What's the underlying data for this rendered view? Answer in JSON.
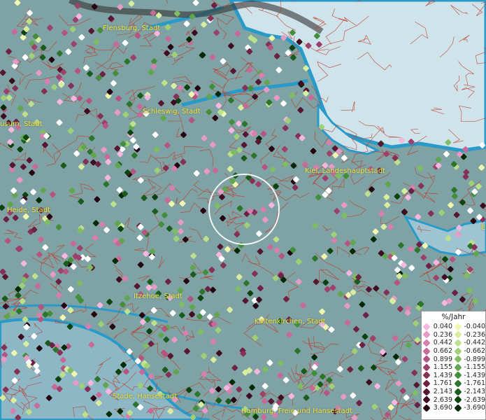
{
  "map": {
    "cities": [
      {
        "id": "flensburg",
        "name": "Flensburg, Stadt"
      },
      {
        "id": "husum",
        "name": "usum, Stadt"
      },
      {
        "id": "schleswig",
        "name": "Schleswig, Stadt"
      },
      {
        "id": "kiel",
        "name": "Kiel, Landeshauptstadt"
      },
      {
        "id": "heide",
        "name": "Heide, Stadt"
      },
      {
        "id": "itzehoe",
        "name": "Itzehoe, Stadt"
      },
      {
        "id": "kaltenkirchen",
        "name": "Kaltenkirchen, Stadt"
      },
      {
        "id": "stade",
        "name": "Stade, Hansestadt"
      },
      {
        "id": "hamburg",
        "name": "Hamburg, Freie und Hansestadt"
      },
      {
        "id": "edge",
        "name": "E"
      }
    ],
    "colors": {
      "land": "#7fa2a4",
      "sea": "#cfe3ea",
      "water_edge": "#2a9bc8",
      "borders": "#c0392b",
      "label": "#f2e23a"
    }
  },
  "legend": {
    "title": "%/Jahr",
    "positive": [
      {
        "value": "0.040",
        "color": "#f5b6e0"
      },
      {
        "value": "0.236",
        "color": "#e89ac7"
      },
      {
        "value": "0.442",
        "color": "#d77fae"
      },
      {
        "value": "0.662",
        "color": "#c76a97"
      },
      {
        "value": "0.899",
        "color": "#b45580"
      },
      {
        "value": "1.155",
        "color": "#9c416a"
      },
      {
        "value": "1.439",
        "color": "#853155"
      },
      {
        "value": "1.761",
        "color": "#6c2343"
      },
      {
        "value": "2.143",
        "color": "#551732"
      },
      {
        "value": "2.639",
        "color": "#3e0d22"
      },
      {
        "value": "3.690",
        "color": "#260512"
      }
    ],
    "negative": [
      {
        "value": "-0.040",
        "color": "#f0f7b0"
      },
      {
        "value": "-0.236",
        "color": "#d8eda0"
      },
      {
        "value": "-0.442",
        "color": "#bde08c"
      },
      {
        "value": "-0.662",
        "color": "#9fd078"
      },
      {
        "value": "-0.899",
        "color": "#7fbd63"
      },
      {
        "value": "-1.155",
        "color": "#5fa64e"
      },
      {
        "value": "-1.439",
        "color": "#438e3c"
      },
      {
        "value": "-1.761",
        "color": "#2c752c"
      },
      {
        "value": "-2.143",
        "color": "#1a5c1e"
      },
      {
        "value": "-2.639",
        "color": "#0c4311"
      },
      {
        "value": "-3.690",
        "color": "#032a06"
      }
    ]
  }
}
